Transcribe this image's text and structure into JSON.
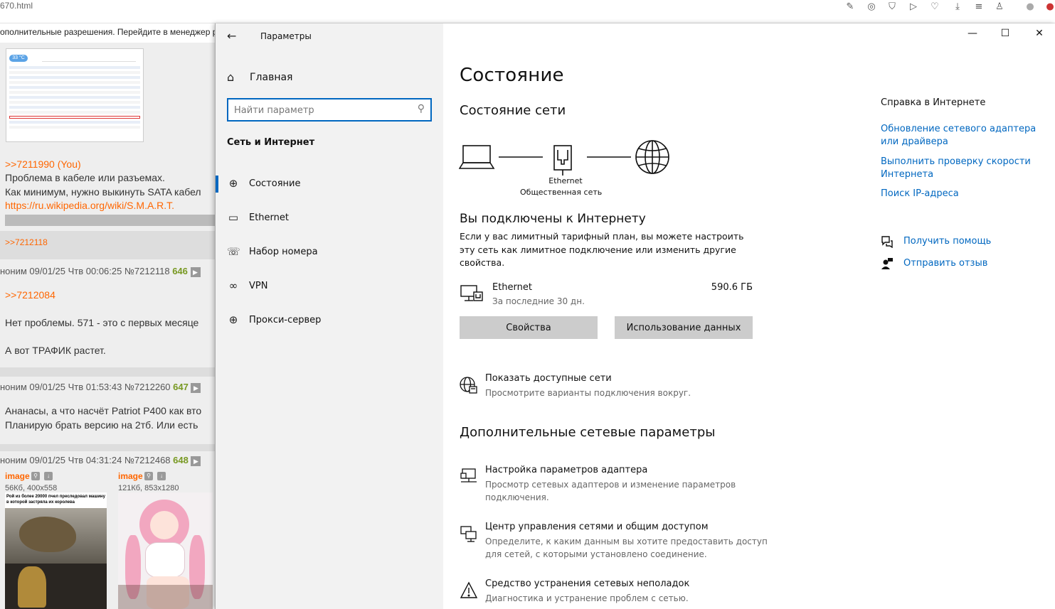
{
  "browser": {
    "url_fragment": "670.html",
    "notice": "ополнительные разрешения. Перейдите в менеджер р"
  },
  "forum": {
    "post1": {
      "reply_ref": ">>7211990 (You)",
      "line1": "Проблема в кабеле или разъемах.",
      "line2": "Как минимум, нужно выкинуть SATA кабел",
      "link": "https://ru.wikipedia.org/wiki/S.M.A.R.T.",
      "backref": ">>7212118"
    },
    "post2": {
      "header": "ноним 09/01/25 Чтв 00:06:25 №7212118",
      "count": "646",
      "reply_ref": ">>7212084",
      "line1": "Нет проблемы. 571 - это с первых месяце",
      "line2": "А вот ТРАФИК растет."
    },
    "post3": {
      "header": "ноним 09/01/25 Чтв 01:53:43 №7212260",
      "count": "647",
      "line1": "Ананасы, а что насчёт Patriot P400 как вто",
      "line2": "Планирую брать версию на 2тб. Или есть"
    },
    "post4": {
      "header": "ноним 09/01/25 Чтв 04:31:24 №7212468",
      "count": "648",
      "img1_label": "image",
      "img1_meta": "56Кб, 400x558",
      "img1_caption": "Рой из более 20000 пчел преследовал машину в которой застряла их королева",
      "img2_label": "image",
      "img2_meta": "121Кб, 853x1280"
    },
    "smart_temp": "33 °C"
  },
  "settings": {
    "window_title": "Параметры",
    "home_label": "Главная",
    "search_placeholder": "Найти параметр",
    "section_title": "Сеть и Интернет",
    "nav_items": [
      {
        "label": "Состояние",
        "icon": "globe-status-icon"
      },
      {
        "label": "Ethernet",
        "icon": "ethernet-icon"
      },
      {
        "label": "Набор номера",
        "icon": "dialup-icon"
      },
      {
        "label": "VPN",
        "icon": "vpn-icon"
      },
      {
        "label": "Прокси-сервер",
        "icon": "proxy-globe-icon"
      }
    ],
    "page_title": "Состояние",
    "status_heading": "Состояние сети",
    "diagram": {
      "adapter_label": "Ethernet",
      "network_type": "Общественная сеть"
    },
    "connected_heading": "Вы подключены к Интернету",
    "connected_desc": "Если у вас лимитный тарифный план, вы можете настроить эту сеть как лимитное подключение или изменить другие свойства.",
    "ethernet_row": {
      "name": "Ethernet",
      "period": "За последние 30 дн.",
      "usage": "590.6 ГБ"
    },
    "buttons": {
      "properties": "Свойства",
      "data_usage": "Использование данных"
    },
    "show_networks": {
      "title": "Показать доступные сети",
      "desc": "Просмотрите варианты подключения вокруг."
    },
    "advanced_heading": "Дополнительные сетевые параметры",
    "advanced_items": [
      {
        "title": "Настройка параметров адаптера",
        "desc": "Просмотр сетевых адаптеров и изменение параметров подключения."
      },
      {
        "title": "Центр управления сетями и общим доступом",
        "desc": "Определите, к каким данным вы хотите предоставить доступ для сетей, с которыми установлено соединение."
      },
      {
        "title": "Средство устранения сетевых неполадок",
        "desc": "Диагностика и устранение проблем с сетью."
      }
    ],
    "help": {
      "heading": "Справка в Интернете",
      "links": [
        "Обновление сетевого адаптера или драйвера",
        "Выполнить проверку скорости Интернета",
        "Поиск IP-адреса"
      ],
      "get_help": "Получить помощь",
      "feedback": "Отправить отзыв"
    }
  },
  "colors": {
    "accent": "#0067c0",
    "forum_link": "#ff6600",
    "forum_count": "#789922",
    "nav_bg": "#f2f2f2",
    "button_bg": "#cccccc"
  }
}
